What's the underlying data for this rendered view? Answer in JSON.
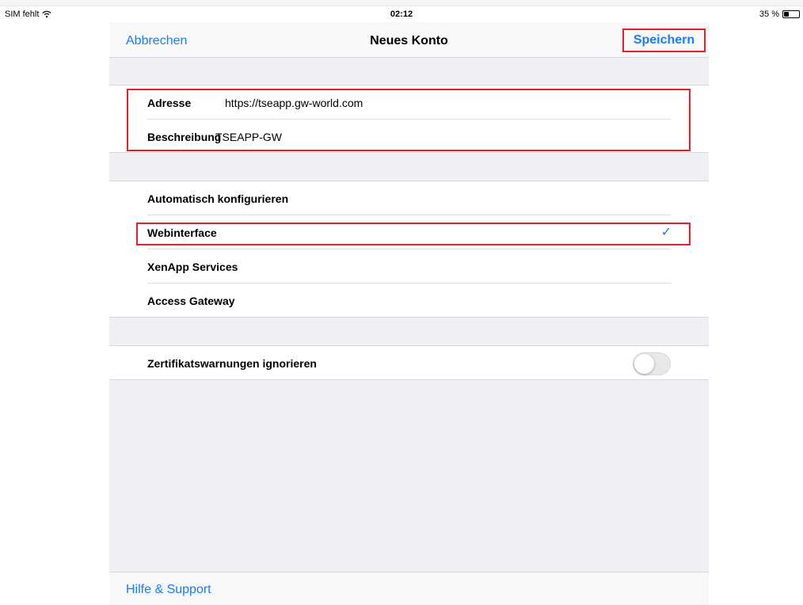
{
  "status_bar": {
    "carrier": "SIM fehlt",
    "time": "02:12",
    "battery": "35 %",
    "battery_level": 0.35
  },
  "navbar": {
    "cancel_label": "Abbrechen",
    "title": "Neues Konto",
    "save_label": "Speichern"
  },
  "account": {
    "address_label": "Adresse",
    "address_value": "https://tseapp.gw-world.com",
    "description_label": "Beschreibung",
    "description_value": "TSEAPP-GW"
  },
  "config_options": [
    {
      "label": "Automatisch konfigurieren",
      "selected": false
    },
    {
      "label": "Webinterface",
      "selected": true
    },
    {
      "label": "XenApp Services",
      "selected": false
    },
    {
      "label": "Access Gateway",
      "selected": false
    }
  ],
  "certificate": {
    "label": "Zertifikatswarnungen ignorieren",
    "enabled": false
  },
  "footer": {
    "help_label": "Hilfe & Support"
  },
  "colors": {
    "accent": "#147efb",
    "highlight": "#e4202d",
    "background": "#efeff4"
  },
  "icons": [
    "wifi-icon",
    "battery-icon",
    "checkmark-icon"
  ]
}
